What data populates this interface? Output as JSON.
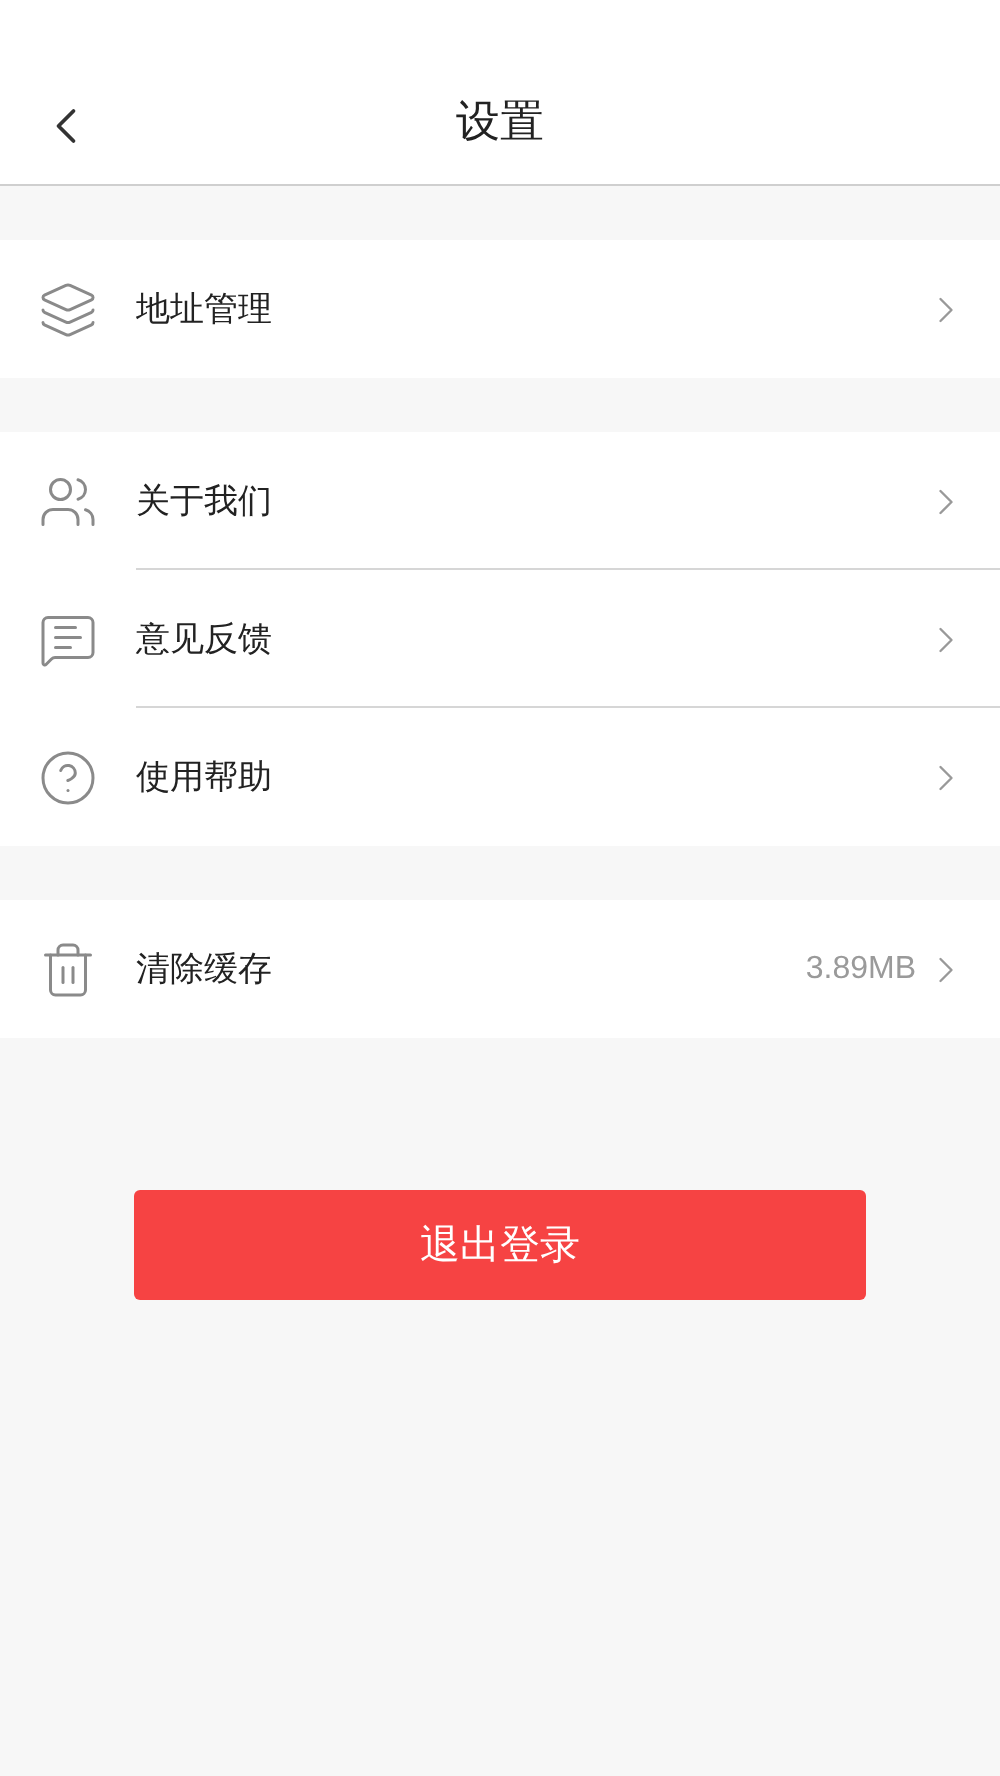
{
  "header": {
    "title": "设置"
  },
  "groups": [
    {
      "items": [
        {
          "label": "地址管理"
        }
      ]
    },
    {
      "items": [
        {
          "label": "关于我们"
        },
        {
          "label": "意见反馈"
        },
        {
          "label": "使用帮助"
        }
      ]
    },
    {
      "items": [
        {
          "label": "清除缓存",
          "value": "3.89MB"
        }
      ]
    }
  ],
  "logout_button": "退出登录"
}
